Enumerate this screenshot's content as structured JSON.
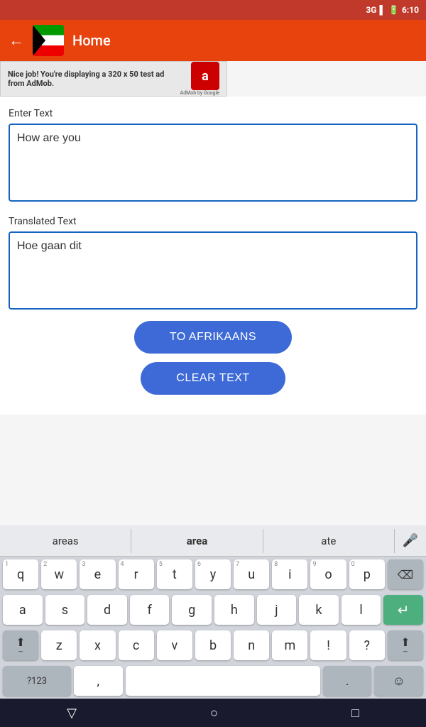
{
  "statusBar": {
    "signal": "3G",
    "time": "6:10",
    "battery": "85"
  },
  "header": {
    "title": "Home",
    "backLabel": "←"
  },
  "ad": {
    "text": "Nice job! You're displaying a 320 x 50 test ad from AdMob.",
    "logoText": "a",
    "attribution": "AdMob by Google"
  },
  "inputSection": {
    "label": "Enter Text",
    "placeholder": "",
    "value": "How are you"
  },
  "translatedSection": {
    "label": "Translated Text",
    "value": "Hoe gaan dit"
  },
  "buttons": {
    "translateLabel": "TO AFRIKAANS",
    "clearLabel": "CLEAR TEXT"
  },
  "keyboard": {
    "suggestions": [
      "areas",
      "area",
      "ate"
    ],
    "rows": [
      [
        "q",
        "w",
        "e",
        "r",
        "t",
        "y",
        "u",
        "i",
        "o",
        "p"
      ],
      [
        "a",
        "s",
        "d",
        "f",
        "g",
        "h",
        "j",
        "k",
        "l"
      ],
      [
        "shift",
        "z",
        "x",
        "c",
        "v",
        "b",
        "n",
        "m",
        "!",
        "?",
        "shift2"
      ],
      [
        "?123",
        ",",
        "space",
        ".",
        "emoji"
      ]
    ],
    "numHints": [
      "1",
      "2",
      "3",
      "4",
      "5",
      "6",
      "7",
      "8",
      "9",
      "0"
    ]
  },
  "bottomNav": {
    "back": "▽",
    "home": "○",
    "recents": "□"
  }
}
